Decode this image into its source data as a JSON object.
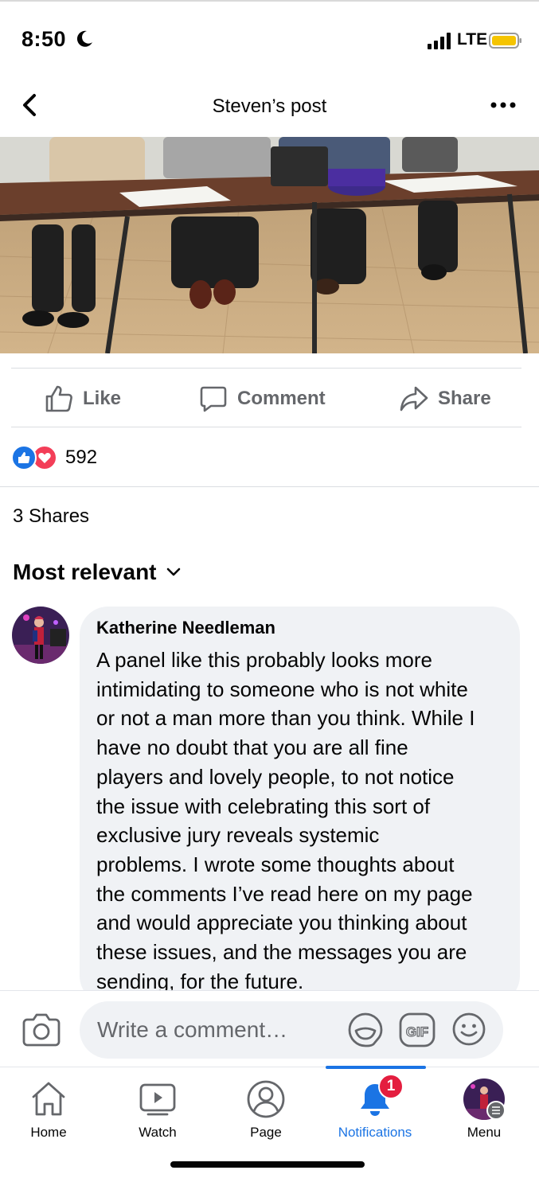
{
  "status_bar": {
    "time": "8:50",
    "network": "LTE",
    "icons": [
      "moon-icon",
      "signal-icon",
      "battery-icon"
    ],
    "battery_color": "#f5c400"
  },
  "header": {
    "title": "Steven’s post",
    "icons": [
      "back-arrow-icon",
      "more-options-icon"
    ]
  },
  "post": {
    "image_description_icon": "post-photo",
    "actions": [
      {
        "label": "Like",
        "icon": "thumbs-up-icon"
      },
      {
        "label": "Comment",
        "icon": "comment-icon"
      },
      {
        "label": "Share",
        "icon": "share-arrow-icon"
      }
    ],
    "reaction_count": "592",
    "reaction_icons": [
      "like-reaction-icon",
      "love-reaction-icon"
    ],
    "shares": "3 Shares"
  },
  "comments": {
    "sort_label": "Most relevant",
    "items": [
      {
        "author": "Katherine Needleman",
        "lines": [
          "A panel like this probably looks more",
          "intimidating to someone who is not white",
          "or not a man more than you think. While I",
          "have no doubt that you are all fine",
          "players and lovely people, to not notice",
          "the issue with celebrating this sort of",
          "exclusive jury reveals systemic",
          "problems. I wrote some thoughts about",
          "the comments I’ve read here on my page",
          "and would appreciate you thinking about",
          "these issues, and the messages you are",
          "sending, for the future."
        ]
      }
    ]
  },
  "composer": {
    "placeholder": "Write a comment…",
    "icons": [
      "camera-icon",
      "sticker-icon",
      "gif-icon",
      "emoji-icon"
    ]
  },
  "tab_bar": {
    "tabs": [
      {
        "label": "Home",
        "icon": "home-icon"
      },
      {
        "label": "Watch",
        "icon": "watch-icon"
      },
      {
        "label": "Page",
        "icon": "page-icon"
      },
      {
        "label": "Notifications",
        "icon": "bell-icon",
        "active": true,
        "badge": "1"
      },
      {
        "label": "Menu",
        "icon": "profile-avatar"
      }
    ],
    "accent": "#1b74e4",
    "badge_color": "#e41e3f"
  }
}
